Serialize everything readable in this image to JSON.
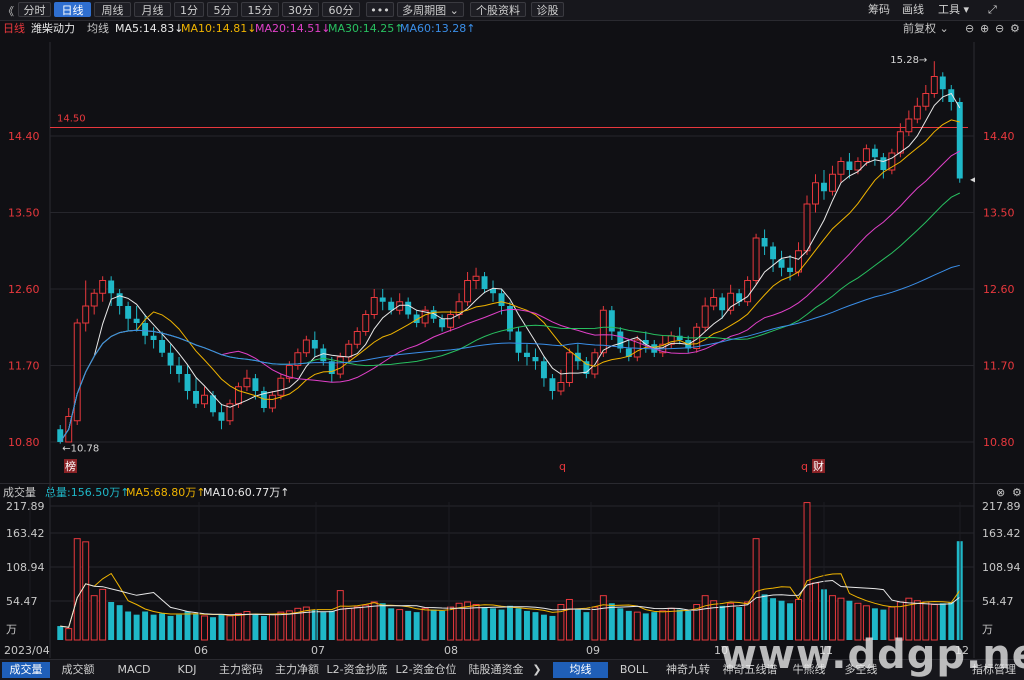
{
  "toolbar": {
    "back": "《",
    "periods": [
      "分时",
      "日线",
      "周线",
      "月线",
      "1分",
      "5分",
      "15分",
      "30分",
      "60分",
      "•••",
      "多周期图 ⌄",
      "个股资料",
      "诊股"
    ],
    "right": {
      "chip": "筹码",
      "draw": "画线",
      "tools": "工具 ▾",
      "expand": "⤢"
    }
  },
  "ma_bar": {
    "period": "日线",
    "stock": "潍柴动力",
    "avg": "均线",
    "items": [
      {
        "text": "MA5:14.83↓",
        "color": "#e8e8e8"
      },
      {
        "text": "MA10:14.81↓",
        "color": "#f0b400"
      },
      {
        "text": "MA20:14.51↓",
        "color": "#e040c8"
      },
      {
        "text": "MA30:14.25↑",
        "color": "#28c060"
      },
      {
        "text": "MA60:13.28↑",
        "color": "#3a8ee8"
      }
    ],
    "adjust": "前复权 ⌄"
  },
  "volume_bar": {
    "label": "成交量",
    "total": "总量:156.50万↑",
    "ma5": "MA5:68.80万↑",
    "ma10": "MA10:60.77万↑"
  },
  "bottom_tabs": {
    "left": [
      "成交量",
      "成交额",
      "MACD",
      "KDJ",
      "主力密码",
      "主力净额",
      "L2-资金抄底",
      "L2-资金仓位",
      "陆股通资金"
    ],
    "right": [
      "均线",
      "BOLL",
      "神奇九转",
      "神奇五线谱",
      "牛熊线",
      "多空线"
    ],
    "manage": "指标管理"
  },
  "watermark": "www.ddgp.net",
  "colors": {
    "up": "#e8383d",
    "down": "#1fb8c8",
    "ma5": "#e8e8e8",
    "ma10": "#f0b400",
    "ma20": "#e040c8",
    "ma30": "#28c060",
    "ma60": "#3a8ee8",
    "ref": "#e8383d"
  },
  "chart_data": {
    "type": "candlestick",
    "price_axis": {
      "ticks": [
        "14.40",
        "13.50",
        "12.60",
        "11.70",
        "10.80"
      ],
      "ylim": [
        10.8,
        14.4
      ]
    },
    "volume_axis": {
      "ticks": [
        "217.89",
        "163.42",
        "108.94",
        "54.47",
        "万"
      ],
      "ylim": [
        0,
        217.89
      ],
      "unit": "万"
    },
    "x_labels": [
      "2023/04",
      "06",
      "07",
      "08",
      "09",
      "10",
      "11",
      "12"
    ],
    "reference_line": {
      "label": "14.50",
      "value": 14.5
    },
    "annotations": {
      "high": "15.28→",
      "low": "←10.78"
    },
    "markers": [
      "榜",
      "q",
      "q",
      "财"
    ],
    "kline": [
      [
        10.95,
        10.8,
        11.0,
        10.78
      ],
      [
        10.8,
        11.1,
        11.2,
        10.8
      ],
      [
        11.05,
        12.2,
        12.25,
        11.0
      ],
      [
        12.2,
        12.4,
        12.7,
        12.1
      ],
      [
        12.4,
        12.55,
        12.6,
        12.3
      ],
      [
        12.55,
        12.7,
        12.75,
        12.45
      ],
      [
        12.7,
        12.55,
        12.75,
        12.4
      ],
      [
        12.55,
        12.4,
        12.6,
        12.3
      ],
      [
        12.4,
        12.25,
        12.45,
        12.1
      ],
      [
        12.25,
        12.2,
        12.4,
        12.1
      ],
      [
        12.2,
        12.05,
        12.3,
        11.95
      ],
      [
        12.05,
        12.0,
        12.15,
        11.9
      ],
      [
        12.0,
        11.85,
        12.1,
        11.8
      ],
      [
        11.85,
        11.7,
        11.95,
        11.6
      ],
      [
        11.7,
        11.6,
        11.8,
        11.5
      ],
      [
        11.6,
        11.4,
        11.7,
        11.3
      ],
      [
        11.4,
        11.25,
        11.55,
        11.2
      ],
      [
        11.25,
        11.35,
        11.45,
        11.2
      ],
      [
        11.35,
        11.15,
        11.4,
        11.1
      ],
      [
        11.15,
        11.05,
        11.25,
        10.95
      ],
      [
        11.05,
        11.25,
        11.3,
        11.0
      ],
      [
        11.25,
        11.45,
        11.5,
        11.2
      ],
      [
        11.45,
        11.55,
        11.65,
        11.4
      ],
      [
        11.55,
        11.4,
        11.6,
        11.3
      ],
      [
        11.4,
        11.2,
        11.45,
        11.15
      ],
      [
        11.2,
        11.35,
        11.4,
        11.15
      ],
      [
        11.35,
        11.55,
        11.6,
        11.3
      ],
      [
        11.55,
        11.7,
        11.75,
        11.5
      ],
      [
        11.7,
        11.85,
        11.9,
        11.65
      ],
      [
        11.85,
        12.0,
        12.05,
        11.8
      ],
      [
        12.0,
        11.9,
        12.1,
        11.8
      ],
      [
        11.9,
        11.75,
        11.95,
        11.7
      ],
      [
        11.75,
        11.6,
        11.8,
        11.5
      ],
      [
        11.6,
        11.8,
        11.85,
        11.55
      ],
      [
        11.8,
        11.95,
        12.0,
        11.75
      ],
      [
        11.95,
        12.1,
        12.15,
        11.9
      ],
      [
        12.1,
        12.3,
        12.35,
        12.05
      ],
      [
        12.3,
        12.5,
        12.6,
        12.25
      ],
      [
        12.5,
        12.45,
        12.6,
        12.35
      ],
      [
        12.45,
        12.35,
        12.5,
        12.3
      ],
      [
        12.35,
        12.45,
        12.55,
        12.3
      ],
      [
        12.45,
        12.3,
        12.5,
        12.25
      ],
      [
        12.3,
        12.2,
        12.35,
        12.15
      ],
      [
        12.2,
        12.35,
        12.4,
        12.15
      ],
      [
        12.35,
        12.25,
        12.4,
        12.2
      ],
      [
        12.25,
        12.15,
        12.3,
        12.1
      ],
      [
        12.15,
        12.3,
        12.35,
        12.1
      ],
      [
        12.3,
        12.45,
        12.55,
        12.25
      ],
      [
        12.45,
        12.7,
        12.8,
        12.4
      ],
      [
        12.7,
        12.75,
        12.85,
        12.6
      ],
      [
        12.75,
        12.6,
        12.8,
        12.55
      ],
      [
        12.6,
        12.55,
        12.7,
        12.45
      ],
      [
        12.55,
        12.4,
        12.6,
        12.3
      ],
      [
        12.4,
        12.1,
        12.45,
        12.0
      ],
      [
        12.1,
        11.85,
        12.15,
        11.75
      ],
      [
        11.85,
        11.8,
        11.95,
        11.7
      ],
      [
        11.8,
        11.75,
        11.9,
        11.65
      ],
      [
        11.75,
        11.55,
        11.8,
        11.45
      ],
      [
        11.55,
        11.4,
        11.6,
        11.3
      ],
      [
        11.4,
        11.5,
        11.65,
        11.35
      ],
      [
        11.5,
        11.85,
        11.9,
        11.45
      ],
      [
        11.85,
        11.75,
        11.95,
        11.65
      ],
      [
        11.75,
        11.6,
        11.8,
        11.55
      ],
      [
        11.6,
        11.85,
        11.9,
        11.55
      ],
      [
        11.85,
        12.35,
        12.4,
        11.8
      ],
      [
        12.35,
        12.1,
        12.4,
        12.0
      ],
      [
        12.1,
        11.9,
        12.15,
        11.85
      ],
      [
        11.9,
        11.8,
        12.0,
        11.75
      ],
      [
        11.8,
        12.0,
        12.05,
        11.75
      ],
      [
        12.0,
        11.95,
        12.1,
        11.85
      ],
      [
        11.95,
        11.85,
        12.0,
        11.8
      ],
      [
        11.85,
        11.95,
        12.05,
        11.8
      ],
      [
        11.95,
        12.05,
        12.1,
        11.9
      ],
      [
        12.05,
        12.0,
        12.15,
        11.95
      ],
      [
        12.0,
        11.9,
        12.05,
        11.85
      ],
      [
        11.9,
        12.15,
        12.2,
        11.85
      ],
      [
        12.15,
        12.4,
        12.5,
        12.1
      ],
      [
        12.4,
        12.5,
        12.6,
        12.35
      ],
      [
        12.5,
        12.35,
        12.55,
        12.25
      ],
      [
        12.35,
        12.55,
        12.65,
        12.3
      ],
      [
        12.55,
        12.45,
        12.6,
        12.4
      ],
      [
        12.45,
        12.7,
        12.75,
        12.4
      ],
      [
        12.7,
        13.2,
        13.25,
        12.65
      ],
      [
        13.2,
        13.1,
        13.3,
        13.0
      ],
      [
        13.1,
        12.95,
        13.15,
        12.8
      ],
      [
        12.95,
        12.85,
        13.05,
        12.75
      ],
      [
        12.85,
        12.8,
        13.0,
        12.7
      ],
      [
        12.8,
        13.05,
        13.15,
        12.75
      ],
      [
        13.05,
        13.6,
        13.7,
        13.0
      ],
      [
        13.6,
        13.85,
        13.95,
        13.5
      ],
      [
        13.85,
        13.75,
        14.0,
        13.65
      ],
      [
        13.75,
        13.95,
        14.05,
        13.7
      ],
      [
        13.95,
        14.1,
        14.15,
        13.85
      ],
      [
        14.1,
        14.0,
        14.2,
        13.9
      ],
      [
        14.0,
        14.1,
        14.15,
        13.95
      ],
      [
        14.1,
        14.25,
        14.3,
        14.05
      ],
      [
        14.25,
        14.15,
        14.3,
        14.05
      ],
      [
        14.15,
        14.0,
        14.2,
        13.9
      ],
      [
        14.0,
        14.2,
        14.25,
        13.95
      ],
      [
        14.2,
        14.45,
        14.55,
        14.15
      ],
      [
        14.45,
        14.6,
        14.7,
        14.4
      ],
      [
        14.6,
        14.75,
        14.85,
        14.55
      ],
      [
        14.75,
        14.9,
        15.0,
        14.7
      ],
      [
        14.9,
        15.1,
        15.28,
        14.85
      ],
      [
        15.1,
        14.95,
        15.15,
        14.8
      ],
      [
        14.95,
        14.8,
        15.0,
        14.7
      ],
      [
        14.8,
        13.9,
        14.85,
        13.85
      ]
    ],
    "volume": [
      22,
      18,
      160,
      155,
      70,
      80,
      60,
      55,
      45,
      40,
      45,
      40,
      42,
      38,
      40,
      45,
      42,
      38,
      36,
      40,
      38,
      42,
      45,
      40,
      38,
      40,
      44,
      46,
      50,
      52,
      48,
      44,
      46,
      78,
      50,
      52,
      55,
      60,
      58,
      50,
      48,
      46,
      44,
      50,
      48,
      46,
      52,
      58,
      60,
      56,
      52,
      50,
      48,
      54,
      50,
      46,
      44,
      40,
      38,
      56,
      64,
      48,
      44,
      52,
      70,
      58,
      50,
      46,
      44,
      42,
      44,
      46,
      50,
      48,
      46,
      56,
      70,
      62,
      54,
      58,
      52,
      60,
      160,
      72,
      66,
      62,
      58,
      64,
      217,
      90,
      80,
      70,
      66,
      62,
      58,
      54,
      50,
      48,
      52,
      60,
      66,
      62,
      60,
      56,
      58,
      60,
      156
    ]
  }
}
